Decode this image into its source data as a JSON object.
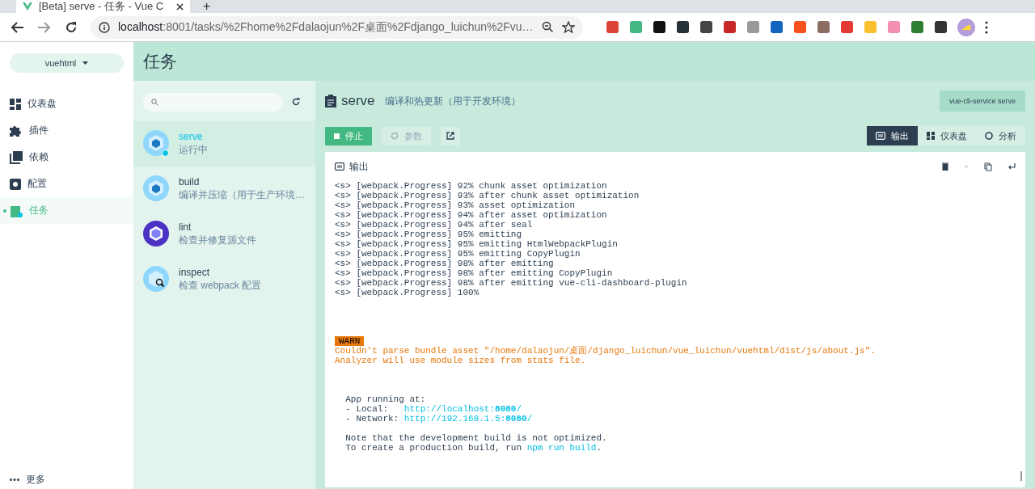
{
  "browser": {
    "tab_title": "[Beta] serve - 任务 - Vue C",
    "new_tab": "+",
    "url_host": "localhost",
    "url_rest": ":8001/tasks/%2Fhome%2Fdalaojun%2F桌面%2Fdjango_luichun%2Fvu…"
  },
  "sidebar": {
    "project": "vuehtml",
    "items": [
      {
        "label": "仪表盘",
        "kind": "dashboard",
        "selected": false
      },
      {
        "label": "插件",
        "kind": "plugins",
        "selected": false
      },
      {
        "label": "依赖",
        "kind": "deps",
        "selected": false
      },
      {
        "label": "配置",
        "kind": "config",
        "selected": false
      },
      {
        "label": "任务",
        "kind": "tasks",
        "selected": true
      }
    ],
    "more": "更多"
  },
  "header": {
    "title": "任务"
  },
  "tasks": [
    {
      "name": "serve",
      "description": "运行中",
      "kind": "webpack",
      "running": true,
      "selected": true
    },
    {
      "name": "build",
      "description": "编译并压缩（用于生产环境…",
      "kind": "webpack",
      "running": false,
      "selected": false
    },
    {
      "name": "lint",
      "description": "检查并修复源文件",
      "kind": "lint",
      "running": false,
      "selected": false
    },
    {
      "name": "inspect",
      "description": "检查 webpack 配置",
      "kind": "inspect",
      "running": false,
      "selected": false
    }
  ],
  "task_detail": {
    "name": "serve",
    "description": "编译和热更新（用于开发环境）",
    "command": "vue-cli-service serve",
    "stop_button": "停止",
    "params_button": "参数",
    "views": [
      {
        "label": "输出",
        "kind": "output",
        "selected": true
      },
      {
        "label": "仪表盘",
        "kind": "dashboard",
        "selected": false
      },
      {
        "label": "分析",
        "kind": "analysis",
        "selected": false
      }
    ]
  },
  "output": {
    "title": "输出",
    "lines": [
      {
        "kind": "text",
        "text": "<s> [webpack.Progress] 92% chunk asset optimization"
      },
      {
        "kind": "text",
        "text": "<s> [webpack.Progress] 93% after chunk asset optimization"
      },
      {
        "kind": "text",
        "text": "<s> [webpack.Progress] 93% asset optimization"
      },
      {
        "kind": "text",
        "text": "<s> [webpack.Progress] 94% after asset optimization"
      },
      {
        "kind": "text",
        "text": "<s> [webpack.Progress] 94% after seal"
      },
      {
        "kind": "text",
        "text": "<s> [webpack.Progress] 95% emitting"
      },
      {
        "kind": "text",
        "text": "<s> [webpack.Progress] 95% emitting HtmlWebpackPlugin"
      },
      {
        "kind": "text",
        "text": "<s> [webpack.Progress] 95% emitting CopyPlugin"
      },
      {
        "kind": "text",
        "text": "<s> [webpack.Progress] 98% after emitting"
      },
      {
        "kind": "text",
        "text": "<s> [webpack.Progress] 98% after emitting CopyPlugin"
      },
      {
        "kind": "text",
        "text": "<s> [webpack.Progress] 98% after emitting vue-cli-dashboard-plugin"
      },
      {
        "kind": "text",
        "text": "<s> [webpack.Progress] 100%"
      },
      {
        "kind": "blank"
      },
      {
        "kind": "blank"
      },
      {
        "kind": "blank"
      },
      {
        "kind": "blank"
      },
      {
        "kind": "badge",
        "text": "WARN"
      },
      {
        "kind": "warning",
        "text": "Couldn't parse bundle asset \"/home/dalaojun/桌面/django_luichun/vue_luichun/vuehtml/dist/js/about.js\"."
      },
      {
        "kind": "warning",
        "text": "Analyzer will use module sizes from stats file."
      },
      {
        "kind": "blank"
      },
      {
        "kind": "blank"
      },
      {
        "kind": "blank"
      },
      {
        "kind": "text",
        "text": "  App running at:"
      },
      {
        "kind": "link",
        "text": "  - Local:   ",
        "link": "http://localhost:**8080**/"
      },
      {
        "kind": "link",
        "text": "  - Network: ",
        "link": "http://192.168.1.5:**8080**/"
      },
      {
        "kind": "blank"
      },
      {
        "kind": "text",
        "text": "  Note that the development build is not optimized."
      },
      {
        "kind": "link",
        "text": "  To create a production build, run ",
        "link": "npm run build",
        "after": "."
      }
    ]
  }
}
